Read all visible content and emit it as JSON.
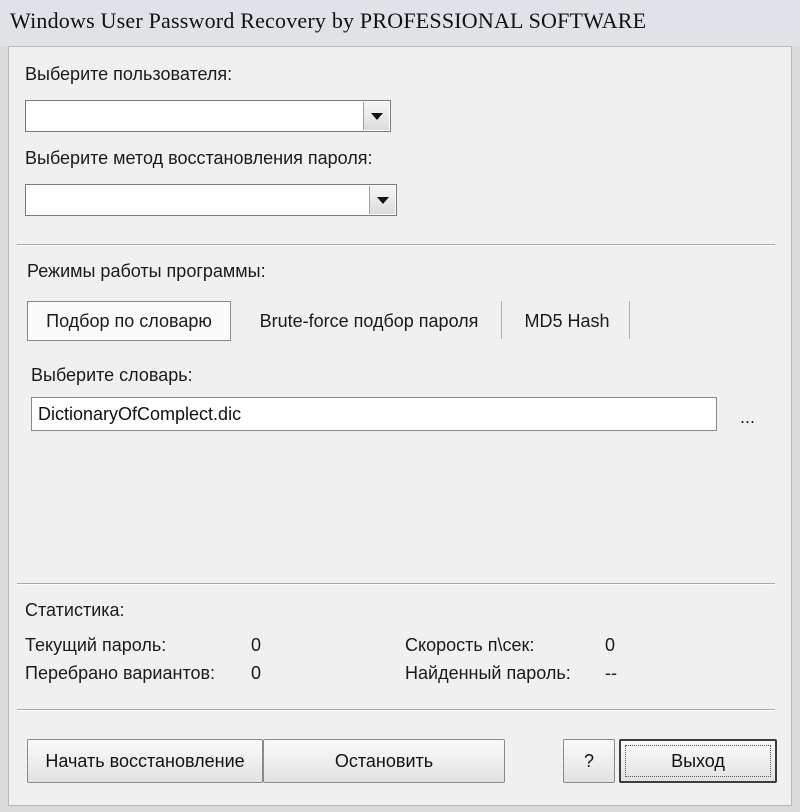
{
  "window": {
    "title": "Windows User Password Recovery by PROFESSIONAL SOFTWARE"
  },
  "user_select": {
    "label": "Выберите пользователя:",
    "value": ""
  },
  "method_select": {
    "label": "Выберите метод восстановления пароля:",
    "value": ""
  },
  "modes": {
    "label": "Режимы работы программы:",
    "tabs": [
      {
        "label": "Подбор по словарю",
        "active": true
      },
      {
        "label": "Brute-force подбор пароля",
        "active": false
      },
      {
        "label": "MD5 Hash",
        "active": false
      }
    ]
  },
  "dictionary": {
    "label": "Выберите словарь:",
    "value": "DictionaryOfComplect.dic",
    "browse_label": "..."
  },
  "stats": {
    "title": "Статистика:",
    "current_password_label": "Текущий пароль:",
    "current_password_value": "0",
    "tried_label": "Перебрано вариантов:",
    "tried_value": "0",
    "speed_label": "Скорость п\\сек:",
    "speed_value": "0",
    "found_label": "Найденный пароль:",
    "found_value": "--"
  },
  "buttons": {
    "start": "Начать восстановление",
    "stop": "Остановить",
    "help": "?",
    "exit": "Выход"
  }
}
